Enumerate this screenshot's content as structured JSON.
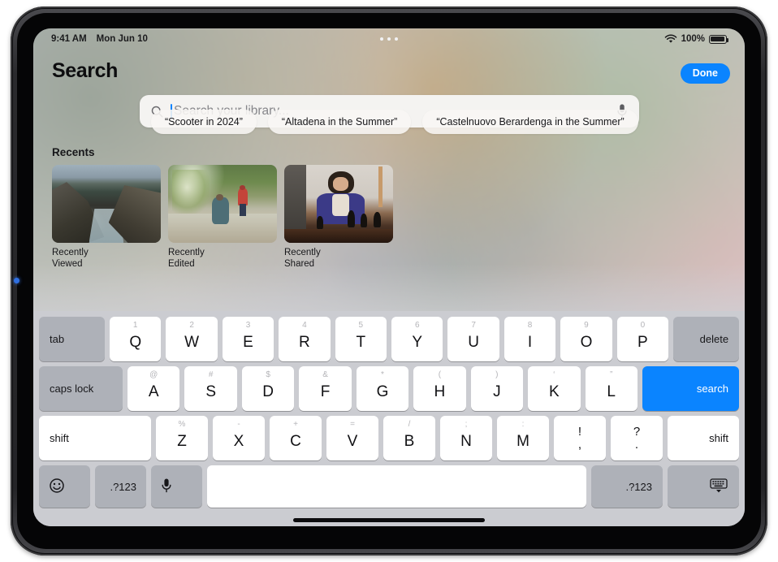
{
  "status_bar": {
    "time": "9:41 AM",
    "date": "Mon Jun 10",
    "battery_percent": "100%",
    "wifi_icon": "wifi-icon",
    "battery_icon": "battery-icon",
    "multitask_dots": "multitasking-dots"
  },
  "header": {
    "title": "Search",
    "done_label": "Done"
  },
  "search": {
    "placeholder": "Search your library...",
    "value": "",
    "search_icon": "search-icon",
    "mic_icon": "microphone-icon"
  },
  "suggestions": [
    {
      "label": "“Scooter in 2024”"
    },
    {
      "label": "“Altadena in the Summer”"
    },
    {
      "label": "“Castelnuovo Berardenga in the Summer”"
    }
  ],
  "recents": {
    "title": "Recents",
    "items": [
      {
        "label": "Recently Viewed",
        "thumb": "coastal-cliffs-photo"
      },
      {
        "label": "Recently Edited",
        "thumb": "stream-hikers-photo"
      },
      {
        "label": "Recently Shared",
        "thumb": "chess-player-photo"
      }
    ]
  },
  "colors": {
    "accent": "#0a84ff",
    "keyboard_bg": "#cbccd1",
    "key_white": "#ffffff",
    "key_modifier": "#aeb1b8"
  },
  "keyboard": {
    "row1": [
      {
        "name": "tab",
        "label": "tab",
        "alt": "",
        "type": "mod tab"
      },
      {
        "name": "q",
        "label": "Q",
        "alt": "1",
        "type": "letter"
      },
      {
        "name": "w",
        "label": "W",
        "alt": "2",
        "type": "letter"
      },
      {
        "name": "e",
        "label": "E",
        "alt": "3",
        "type": "letter"
      },
      {
        "name": "r",
        "label": "R",
        "alt": "4",
        "type": "letter"
      },
      {
        "name": "t",
        "label": "T",
        "alt": "5",
        "type": "letter"
      },
      {
        "name": "y",
        "label": "Y",
        "alt": "6",
        "type": "letter"
      },
      {
        "name": "u",
        "label": "U",
        "alt": "7",
        "type": "letter"
      },
      {
        "name": "i",
        "label": "I",
        "alt": "8",
        "type": "letter"
      },
      {
        "name": "o",
        "label": "O",
        "alt": "9",
        "type": "letter"
      },
      {
        "name": "p",
        "label": "P",
        "alt": "0",
        "type": "letter"
      },
      {
        "name": "delete",
        "label": "delete",
        "alt": "",
        "type": "mod delete"
      }
    ],
    "row2": [
      {
        "name": "caps-lock",
        "label": "caps lock",
        "alt": "",
        "type": "mod caps"
      },
      {
        "name": "a",
        "label": "A",
        "alt": "@",
        "type": "letter"
      },
      {
        "name": "s",
        "label": "S",
        "alt": "#",
        "type": "letter"
      },
      {
        "name": "d",
        "label": "D",
        "alt": "$",
        "type": "letter"
      },
      {
        "name": "f",
        "label": "F",
        "alt": "&",
        "type": "letter"
      },
      {
        "name": "g",
        "label": "G",
        "alt": "*",
        "type": "letter"
      },
      {
        "name": "h",
        "label": "H",
        "alt": "(",
        "type": "letter"
      },
      {
        "name": "j",
        "label": "J",
        "alt": ")",
        "type": "letter"
      },
      {
        "name": "k",
        "label": "K",
        "alt": "‘",
        "type": "letter"
      },
      {
        "name": "l",
        "label": "L",
        "alt": "”",
        "type": "letter"
      },
      {
        "name": "search-return",
        "label": "search",
        "alt": "",
        "type": "blue ret"
      }
    ],
    "row3": [
      {
        "name": "shift-left",
        "label": "shift",
        "alt": "",
        "type": "light shiftL"
      },
      {
        "name": "z",
        "label": "Z",
        "alt": "%",
        "type": "letter"
      },
      {
        "name": "x",
        "label": "X",
        "alt": "-",
        "type": "letter"
      },
      {
        "name": "c",
        "label": "C",
        "alt": "+",
        "type": "letter"
      },
      {
        "name": "v",
        "label": "V",
        "alt": "=",
        "type": "letter"
      },
      {
        "name": "b",
        "label": "B",
        "alt": "/",
        "type": "letter"
      },
      {
        "name": "n",
        "label": "N",
        "alt": ";",
        "type": "letter"
      },
      {
        "name": "m",
        "label": "M",
        "alt": ":",
        "type": "letter"
      },
      {
        "name": "exclaim-comma",
        "top": "!",
        "bot": ",",
        "type": "punc"
      },
      {
        "name": "question-period",
        "top": "?",
        "bot": ".",
        "type": "punc"
      },
      {
        "name": "shift-right",
        "label": "shift",
        "alt": "",
        "type": "light shiftR"
      }
    ],
    "row4": [
      {
        "name": "emoji",
        "label": "",
        "icon": "emoji-smiley-icon",
        "type": "mod sq icoL"
      },
      {
        "name": "numbers-left",
        "label": ".?123",
        "type": "mod sq2 numL"
      },
      {
        "name": "dictation",
        "label": "",
        "icon": "microphone-icon",
        "type": "mod sq icoL"
      },
      {
        "name": "space",
        "label": "",
        "type": "space"
      },
      {
        "name": "numbers-right",
        "label": ".?123",
        "type": "mod num-r"
      },
      {
        "name": "dismiss-keyboard",
        "label": "",
        "icon": "keyboard-dismiss-icon",
        "type": "mod dismiss"
      }
    ]
  }
}
